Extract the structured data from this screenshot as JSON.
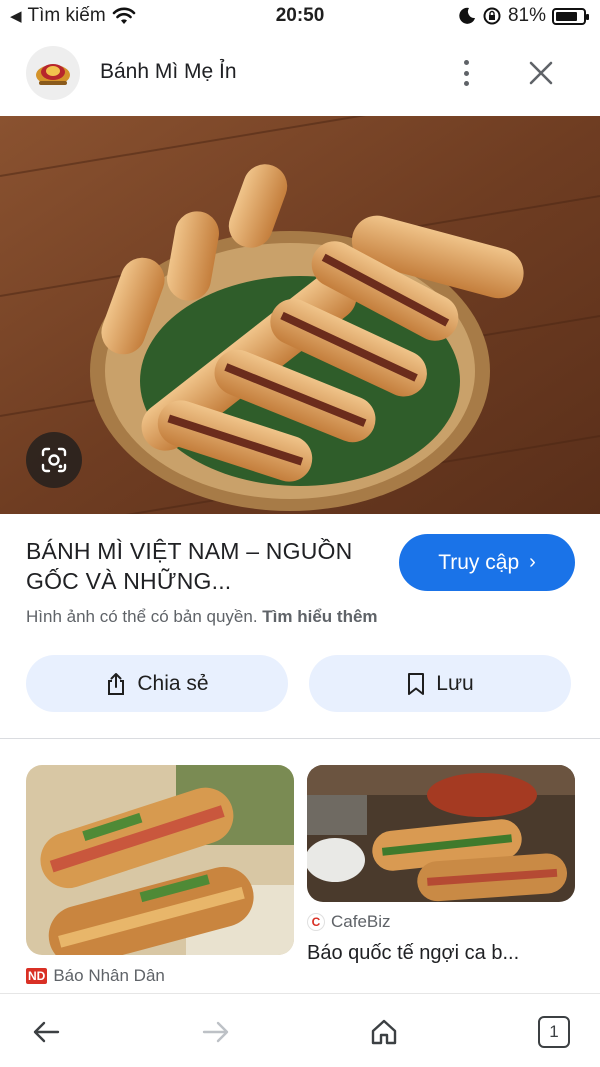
{
  "status_bar": {
    "back_app": "Tìm kiếm",
    "time": "20:50",
    "battery_percent": "81%",
    "battery_level": 0.81,
    "icons": [
      "back-arrow-icon",
      "wifi-icon",
      "moon-icon",
      "rotation-lock-icon",
      "battery-icon"
    ]
  },
  "header": {
    "site_name": "Bánh Mì Mẹ Ỉn",
    "icons": [
      "site-logo",
      "more-vert-icon",
      "close-icon"
    ]
  },
  "hero": {
    "icons": [
      "lens-icon"
    ]
  },
  "result": {
    "title": "BÁNH MÌ VIỆT NAM – NGUỒN GỐC VÀ NHỮNG...",
    "visit_label": "Truy cập",
    "copyright_text": "Hình ảnh có thể có bản quyền.",
    "learn_more": "Tìm hiểu thêm"
  },
  "actions": {
    "share_label": "Chia sẻ",
    "save_label": "Lưu"
  },
  "related": [
    {
      "source": "Báo Nhân Dân",
      "logo_text": "ND",
      "title": ""
    },
    {
      "source": "CafeBiz",
      "logo_text": "C",
      "title": "Báo quốc tế ngợi ca b..."
    }
  ],
  "bottom_nav": {
    "tab_count": "1",
    "icons": [
      "back-arrow-icon",
      "forward-arrow-icon",
      "home-icon",
      "tabs-icon"
    ]
  },
  "colors": {
    "accent": "#1a73e8",
    "chip_bg": "#e8f0fe",
    "text_secondary": "#5f6368"
  }
}
